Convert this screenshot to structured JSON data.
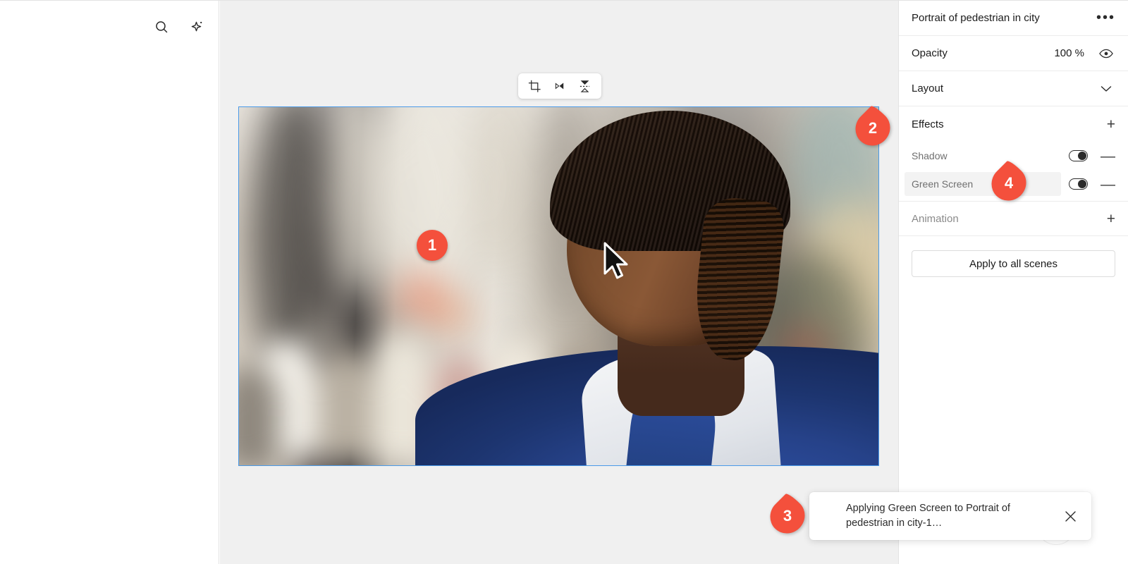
{
  "app": {
    "canvas_bg": "#f0f0f0",
    "accent": "#f4503c",
    "selection_color": "#4a9ae8"
  },
  "sidebar": {
    "tools": [
      {
        "name": "search-icon",
        "label": "Search"
      },
      {
        "name": "magic-sparkle-icon",
        "label": "Magic"
      }
    ]
  },
  "media_toolbar": {
    "items": [
      {
        "name": "crop-icon",
        "label": "Crop"
      },
      {
        "name": "trim-icon",
        "label": "Trim"
      },
      {
        "name": "flip-vertical-icon",
        "label": "Flip vertical"
      }
    ]
  },
  "media": {
    "alt": "Portrait of a smiling man with locs wearing a blue quarter-zip sweater over a white collared shirt, blurred city street behind him",
    "selected": true
  },
  "panel": {
    "title": "Portrait of pedestrian in city",
    "more_label": "•••",
    "opacity": {
      "label": "Opacity",
      "value": "100 %",
      "visibility_icon": "eye-icon"
    },
    "layout": {
      "label": "Layout",
      "chevron": "chevron-down-icon"
    },
    "effects": {
      "label": "Effects",
      "add_label": "+",
      "items": [
        {
          "label": "Shadow",
          "enabled": true,
          "remove_label": "—"
        },
        {
          "label": "Green Screen",
          "enabled": true,
          "remove_label": "—",
          "selected": true
        }
      ]
    },
    "animation": {
      "label": "Animation",
      "add_label": "+"
    },
    "apply_button": "Apply to all scenes"
  },
  "toast": {
    "message": "Applying Green Screen to Portrait of pedestrian in city-1…",
    "close_label": "×"
  },
  "annotations": [
    {
      "number": "1",
      "shape": "circle",
      "target": "canvas-cursor"
    },
    {
      "number": "2",
      "shape": "teardrop",
      "target": "effects-row"
    },
    {
      "number": "3",
      "shape": "teardrop",
      "target": "toast"
    },
    {
      "number": "4",
      "shape": "teardrop",
      "target": "green-screen-toggle"
    }
  ]
}
